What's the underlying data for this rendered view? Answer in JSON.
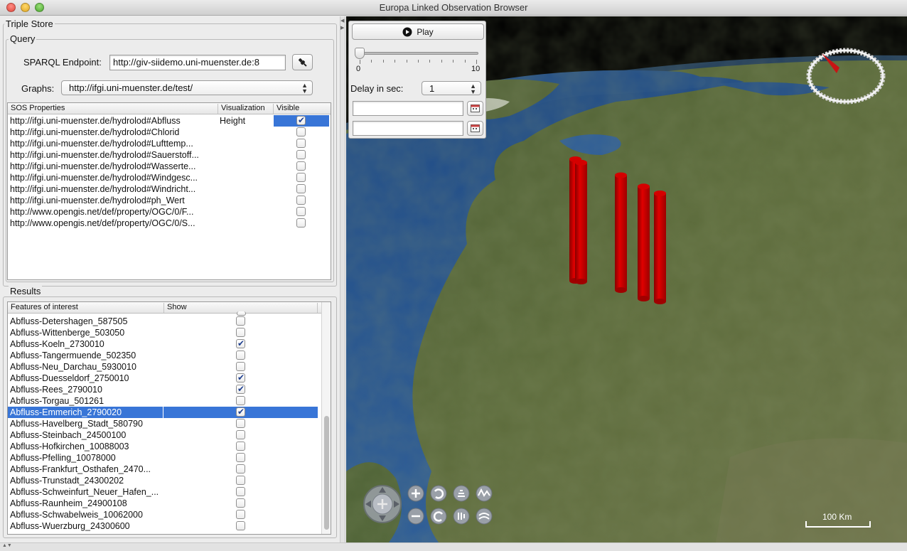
{
  "window": {
    "title": "Europa Linked Observation Browser"
  },
  "triple_store": {
    "legend": "Triple Store",
    "query": {
      "legend": "Query",
      "endpoint_label": "SPARQL Endpoint:",
      "endpoint_value": "http://giv-siidemo.uni-muenster.de:8",
      "graphs_label": "Graphs:",
      "graphs_value": "http://ifgi.uni-muenster.de/test/"
    },
    "sos_table": {
      "headers": [
        "SOS Properties",
        "Visualization",
        "Visible"
      ],
      "rows": [
        {
          "property": "http://ifgi.uni-muenster.de/hydrolod#Abfluss",
          "visualization": "Height",
          "visible": true,
          "selected": true
        },
        {
          "property": "http://ifgi.uni-muenster.de/hydrolod#Chlorid",
          "visualization": "",
          "visible": false
        },
        {
          "property": "http://ifgi.uni-muenster.de/hydrolod#Lufttemp...",
          "visualization": "",
          "visible": false
        },
        {
          "property": "http://ifgi.uni-muenster.de/hydrolod#Sauerstoff...",
          "visualization": "",
          "visible": false
        },
        {
          "property": "http://ifgi.uni-muenster.de/hydrolod#Wasserte...",
          "visualization": "",
          "visible": false
        },
        {
          "property": "http://ifgi.uni-muenster.de/hydrolod#Windgesc...",
          "visualization": "",
          "visible": false
        },
        {
          "property": "http://ifgi.uni-muenster.de/hydrolod#Windricht...",
          "visualization": "",
          "visible": false
        },
        {
          "property": "http://ifgi.uni-muenster.de/hydrolod#ph_Wert",
          "visualization": "",
          "visible": false
        },
        {
          "property": "http://www.opengis.net/def/property/OGC/0/F...",
          "visualization": "",
          "visible": false
        },
        {
          "property": "http://www.opengis.net/def/property/OGC/0/S...",
          "visualization": "",
          "visible": false
        }
      ]
    }
  },
  "results": {
    "legend": "Results",
    "headers": [
      "Features of interest",
      "Show"
    ],
    "rows": [
      {
        "name": "Abfluss-Detershagen_587505",
        "show": false
      },
      {
        "name": "Abfluss-Wittenberge_503050",
        "show": false
      },
      {
        "name": "Abfluss-Koeln_2730010",
        "show": true
      },
      {
        "name": "Abfluss-Tangermuende_502350",
        "show": false
      },
      {
        "name": "Abfluss-Neu_Darchau_5930010",
        "show": false
      },
      {
        "name": "Abfluss-Duesseldorf_2750010",
        "show": true
      },
      {
        "name": "Abfluss-Rees_2790010",
        "show": true
      },
      {
        "name": "Abfluss-Torgau_501261",
        "show": false
      },
      {
        "name": "Abfluss-Emmerich_2790020",
        "show": true,
        "selected": true
      },
      {
        "name": "Abfluss-Havelberg_Stadt_580790",
        "show": false
      },
      {
        "name": "Abfluss-Steinbach_24500100",
        "show": false
      },
      {
        "name": "Abfluss-Hofkirchen_10088003",
        "show": false
      },
      {
        "name": "Abfluss-Pfelling_10078000",
        "show": false
      },
      {
        "name": "Abfluss-Frankfurt_Osthafen_2470...",
        "show": false
      },
      {
        "name": "Abfluss-Trunstadt_24300202",
        "show": false
      },
      {
        "name": "Abfluss-Schweinfurt_Neuer_Hafen_...",
        "show": false
      },
      {
        "name": "Abfluss-Raunheim_24900108",
        "show": false
      },
      {
        "name": "Abfluss-Schwabelweis_10062000",
        "show": false
      },
      {
        "name": "Abfluss-Wuerzburg_24300600",
        "show": false
      }
    ]
  },
  "playback": {
    "play_label": "Play",
    "slider_min": "0",
    "slider_max": "10",
    "slider_value": 0,
    "delay_label": "Delay in sec:",
    "delay_value": "1",
    "date_from": "",
    "date_to": ""
  },
  "map": {
    "scale_label": "100 Km",
    "ocean_color": "#1f4f8c",
    "land_color": "#5a6b3a",
    "bar_color": "#d40000",
    "bars": [
      {
        "station": "Abfluss-Emmerich_2790020",
        "value": 0.9
      },
      {
        "station": "Abfluss-Rees_2790010",
        "value": 0.88
      },
      {
        "station": "Abfluss-Duesseldorf_2750010",
        "value": 0.85
      },
      {
        "station": "Abfluss-Koeln_2730010",
        "value": 0.83
      },
      {
        "station": "Abfluss-Koeln_2730010",
        "value": 0.8
      }
    ],
    "nav_icons": [
      "pan-icon",
      "zoom-in-icon",
      "rotate-left-icon",
      "tilt-up-icon",
      "terrain-up-icon",
      "zoom-out-icon",
      "rotate-right-icon",
      "tilt-down-icon",
      "terrain-down-icon"
    ]
  }
}
